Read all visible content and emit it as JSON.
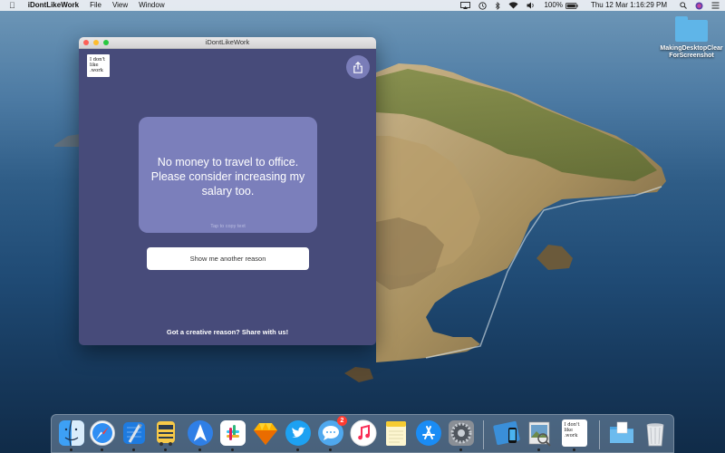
{
  "menubar": {
    "app_name": "iDontLikeWork",
    "menus": [
      "File",
      "View",
      "Window"
    ],
    "battery_percent": "100%",
    "datetime": "Thu 12 Mar  1:16:29 PM"
  },
  "desktop": {
    "folder_label": "MakingDesktopClearForScreenshot"
  },
  "window": {
    "title": "iDontLikeWork",
    "logo_lines": [
      "I don't",
      "like",
      ".work"
    ],
    "reason_text": "No money to travel to office. Please consider increasing my salary too.",
    "copy_hint": "Tap to copy text",
    "another_button_label": "Show me another reason",
    "share_cta": "Got a creative reason? Share with us!"
  },
  "dock": {
    "items": [
      {
        "name": "finder",
        "icon": "finder-icon"
      },
      {
        "name": "safari",
        "icon": "safari-icon"
      },
      {
        "name": "xcode",
        "icon": "xcode-icon"
      },
      {
        "name": "transmit",
        "icon": "truck-icon"
      },
      {
        "name": "spark",
        "icon": "paper-plane-icon"
      },
      {
        "name": "slack",
        "icon": "slack-icon"
      },
      {
        "name": "sketch",
        "icon": "diamond-icon"
      },
      {
        "name": "twitter",
        "icon": "bird-icon"
      },
      {
        "name": "messages",
        "icon": "chat-bubble-icon",
        "badge": "2"
      },
      {
        "name": "music",
        "icon": "music-note-icon"
      },
      {
        "name": "notes",
        "icon": "notes-icon"
      },
      {
        "name": "app-store",
        "icon": "app-store-icon"
      },
      {
        "name": "system-preferences",
        "icon": "gear-icon"
      },
      {
        "name": "simulator",
        "icon": "simulator-icon"
      },
      {
        "name": "preview",
        "icon": "preview-icon"
      },
      {
        "name": "idontlikework",
        "icon": "app-logo-icon"
      },
      {
        "name": "downloads",
        "icon": "folder-icon"
      },
      {
        "name": "trash",
        "icon": "trash-icon"
      }
    ]
  },
  "colors": {
    "window_bg": "#474b7a",
    "card_bg": "#7b7fbb",
    "share_button_bg": "#7a7db8"
  }
}
